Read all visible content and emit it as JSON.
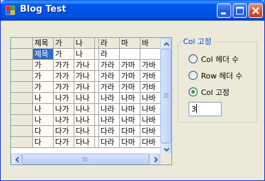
{
  "window": {
    "title": "Blog Test"
  },
  "grid": {
    "header": [
      "제목",
      "가",
      "나",
      "",
      "라",
      "마",
      "바"
    ],
    "rows": [
      [
        "제목",
        "가",
        "나",
        "",
        "라",
        "",
        ""
      ],
      [
        "가",
        "가가",
        "가나",
        "",
        "가라",
        "가마",
        "가바"
      ],
      [
        "가",
        "가가",
        "가나",
        "",
        "가라",
        "가마",
        "가바"
      ],
      [
        "가",
        "가가",
        "가나",
        "",
        "가라",
        "가마",
        "가바"
      ],
      [
        "나",
        "나가",
        "나나",
        "",
        "나라",
        "나마",
        "나바"
      ],
      [
        "나",
        "나가",
        "나나",
        "",
        "나라",
        "나마",
        "나바"
      ],
      [
        "나",
        "나가",
        "나나",
        "",
        "나라",
        "나마",
        "나바"
      ],
      [
        "다",
        "다가",
        "다나",
        "",
        "다라",
        "다마",
        "다바"
      ],
      [
        "다",
        "다가",
        "다나",
        "",
        "다라",
        "다마",
        "다바"
      ]
    ]
  },
  "options": {
    "group_label": "Col 고정",
    "radios": [
      {
        "label": "Col 헤더 수",
        "checked": false
      },
      {
        "label": "Row 헤더 수",
        "checked": false
      },
      {
        "label": "Col 고정",
        "checked": true
      }
    ],
    "input_value": "3"
  },
  "colors": {
    "accent": "#316AC5",
    "titlebar": "#0053E5",
    "group_label": "#0046D5",
    "radio_check": "#2FA12F"
  }
}
